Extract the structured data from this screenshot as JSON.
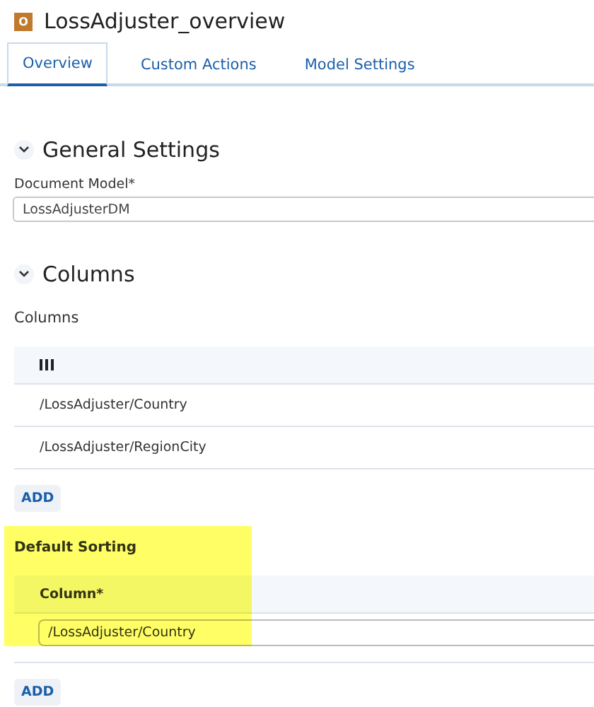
{
  "header": {
    "badge": "O",
    "title": "LossAdjuster_overview"
  },
  "tabs": [
    {
      "label": "Overview",
      "selected": true
    },
    {
      "label": "Custom Actions",
      "selected": false
    },
    {
      "label": "Model Settings",
      "selected": false
    }
  ],
  "general_settings": {
    "title": "General Settings",
    "expanded": true,
    "field_label": "Document Model*",
    "value": "LossAdjusterDM"
  },
  "columns_section": {
    "title": "Columns",
    "expanded": true,
    "label": "Columns",
    "rows": [
      "/LossAdjuster/Country",
      "/LossAdjuster/RegionCity"
    ],
    "add_button": "ADD"
  },
  "default_sorting": {
    "label": "Default Sorting",
    "highlighted": true,
    "column_header": "Column*",
    "value": "/LossAdjuster/Country",
    "add_button": "ADD"
  }
}
